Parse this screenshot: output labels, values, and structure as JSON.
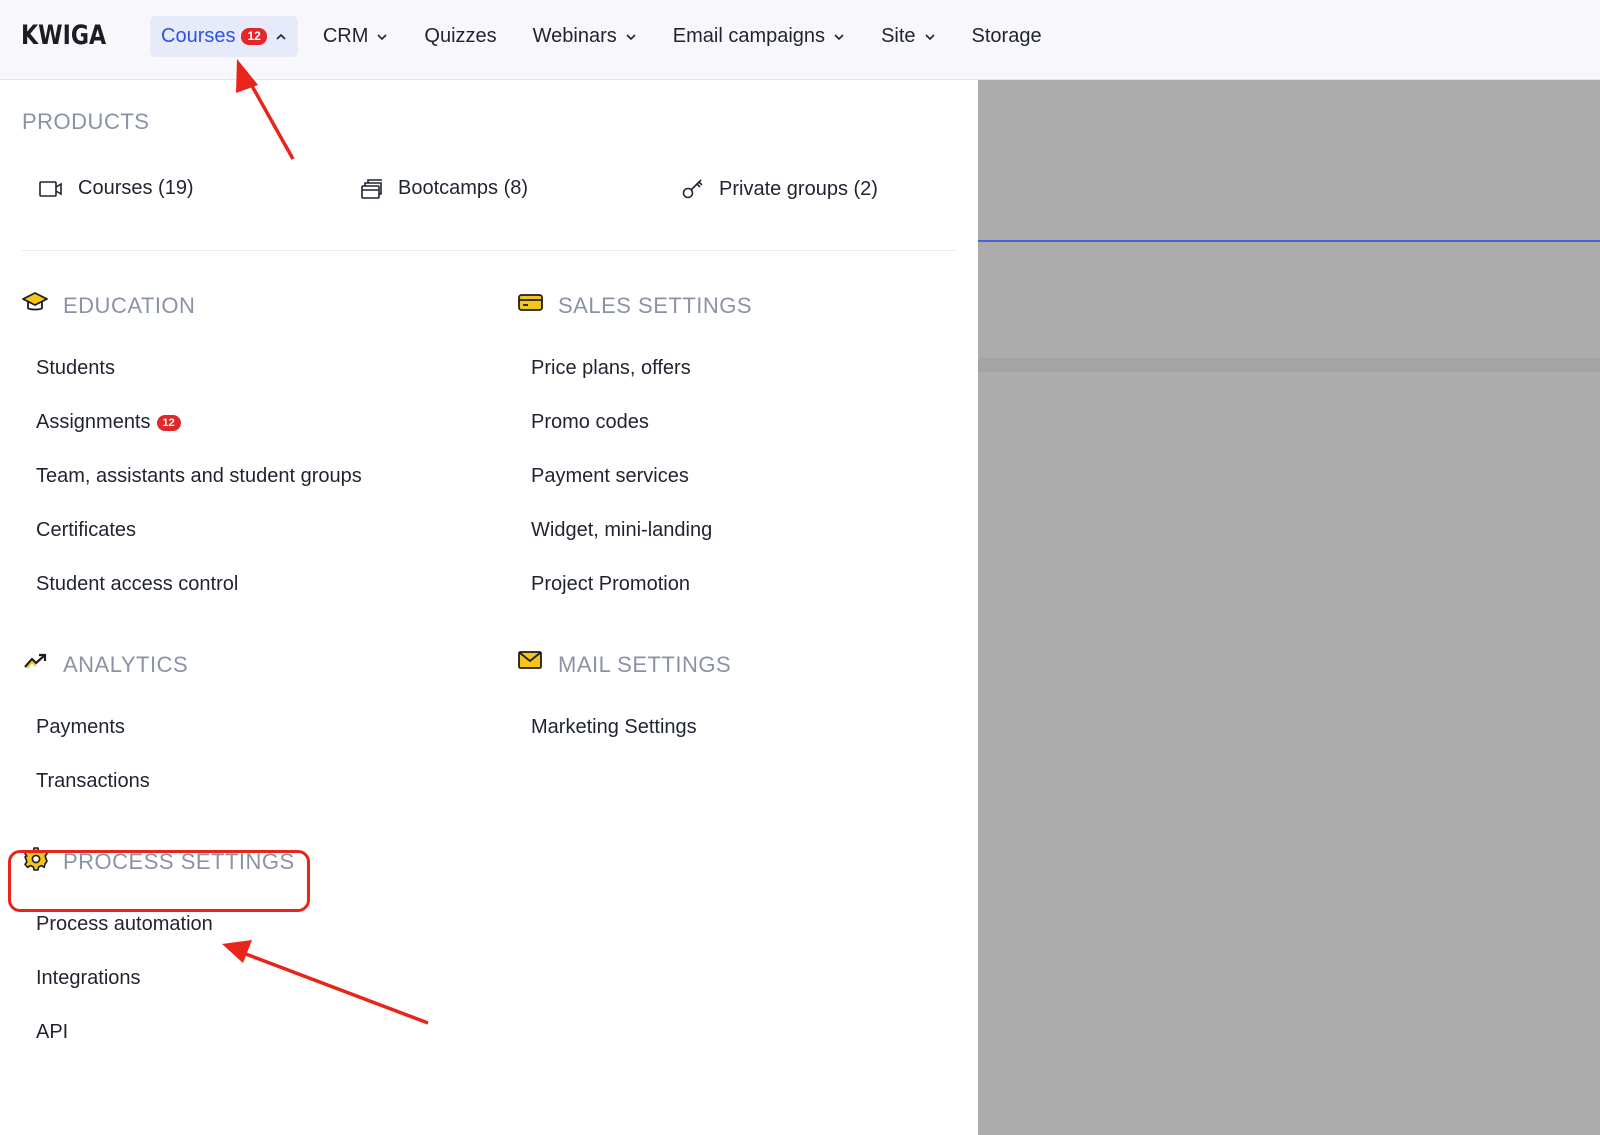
{
  "brand": {
    "logo": "KWIGA"
  },
  "nav": {
    "courses": {
      "label": "Courses",
      "badge": "12"
    },
    "crm": "CRM",
    "quizzes": "Quizzes",
    "webinars": "Webinars",
    "email": "Email campaigns",
    "site": "Site",
    "storage": "Storage"
  },
  "products": {
    "heading": "PRODUCTS",
    "courses": "Courses (19)",
    "bootcamps": "Bootcamps (8)",
    "private_groups": "Private groups (2)"
  },
  "education": {
    "heading": "EDUCATION",
    "students": "Students",
    "assignments": "Assignments",
    "assignments_badge": "12",
    "team": "Team, assistants and student groups",
    "certificates": "Certificates",
    "access": "Student access control"
  },
  "sales": {
    "heading": "SALES SETTINGS",
    "price": "Price plans, offers",
    "promo": "Promo codes",
    "payment": "Payment services",
    "widget": "Widget, mini-landing",
    "promotion": "Project Promotion"
  },
  "analytics": {
    "heading": "ANALYTICS",
    "payments": "Payments",
    "transactions": "Transactions"
  },
  "mail": {
    "heading": "MAIL SETTINGS",
    "marketing": "Marketing Settings"
  },
  "process": {
    "heading": "PROCESS SETTINGS",
    "automation": "Process automation",
    "integrations": "Integrations",
    "api": "API"
  },
  "colors": {
    "accent": "#2f52e0",
    "badge": "#e0272a",
    "annotation": "#e8241b",
    "icon_yellow": "#f5c518"
  }
}
